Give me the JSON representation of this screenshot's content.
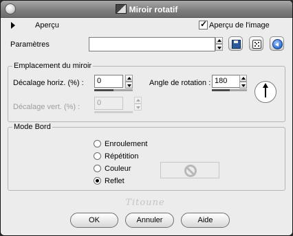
{
  "window": {
    "title": "Miroir rotatif"
  },
  "preview_row": {
    "apercu_label": "Aperçu",
    "checkbox_label": "Aperçu de l'image",
    "checkbox_checked": true
  },
  "presets": {
    "label": "Paramètres",
    "value": ""
  },
  "mirror_group": {
    "legend": "Emplacement du miroir",
    "horiz_label": "Décalage horiz. (%) :",
    "horiz_value": "0",
    "vert_label": "Décalage vert. (%) :",
    "vert_value": "0",
    "vert_enabled": false,
    "angle_label": "Angle de rotation :",
    "angle_value": "180"
  },
  "edge_group": {
    "legend": "Mode Bord",
    "options": [
      "Enroulement",
      "Répétition",
      "Couleur",
      "Reflet"
    ],
    "selected": "Reflet"
  },
  "signature": "Titoune",
  "buttons": {
    "ok": "OK",
    "cancel": "Annuler",
    "help": "Aide"
  },
  "colors": {
    "title_bar": "#7c7c7c",
    "dialog_bg": "#ececec"
  },
  "icons": [
    "title-app-icon",
    "save-icon",
    "dice-icon",
    "reset-icon",
    "rotation-dial-icon",
    "no-color-icon"
  ]
}
